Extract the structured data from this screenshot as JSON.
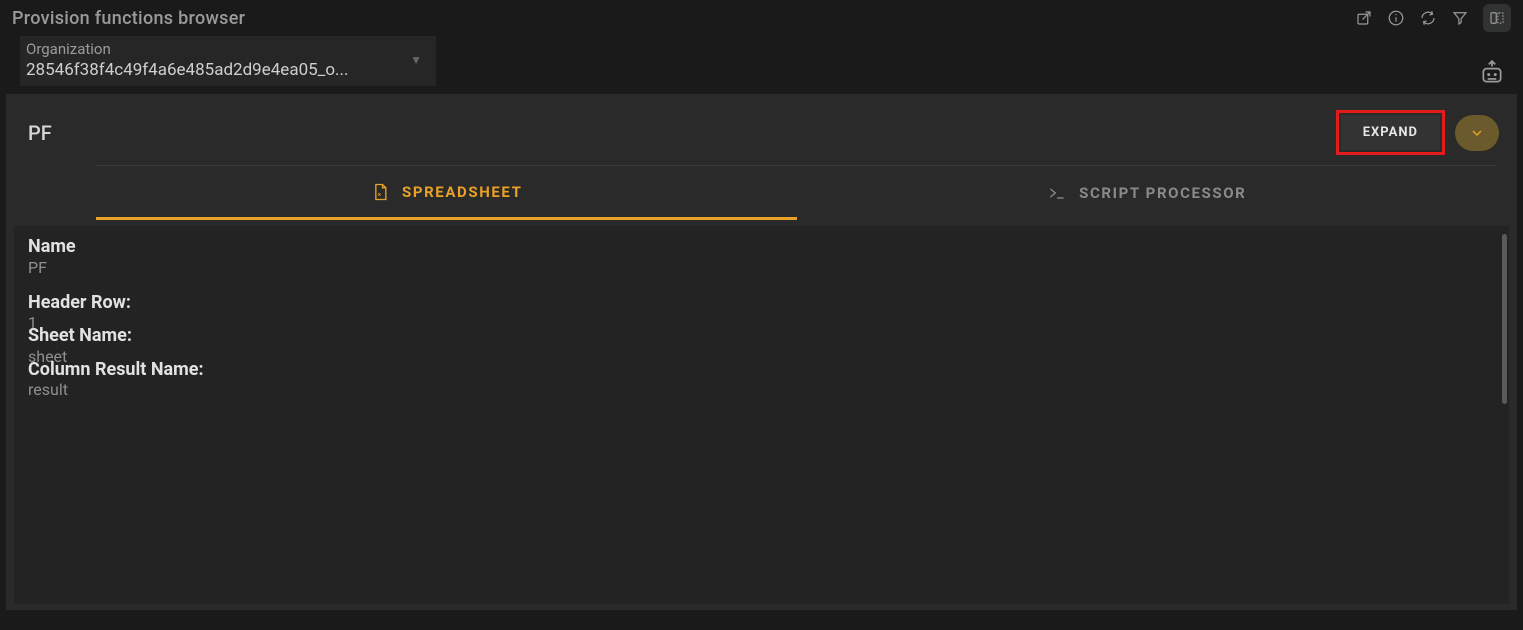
{
  "header": {
    "title": "Provision functions browser"
  },
  "org": {
    "label": "Organization",
    "value": "28546f38f4c49f4a6e485ad2d9e4ea05_o..."
  },
  "panel": {
    "title": "PF",
    "expand_label": "EXPAND"
  },
  "tabs": {
    "spreadsheet": "SPREADSHEET",
    "script": "SCRIPT PROCESSOR"
  },
  "details": {
    "name_label": "Name",
    "name_value": "PF",
    "header_row_label": "Header Row:",
    "header_row_value": "1",
    "sheet_name_label": "Sheet Name:",
    "sheet_name_value": "sheet",
    "col_result_label": "Column Result Name:",
    "col_result_value": "result"
  }
}
